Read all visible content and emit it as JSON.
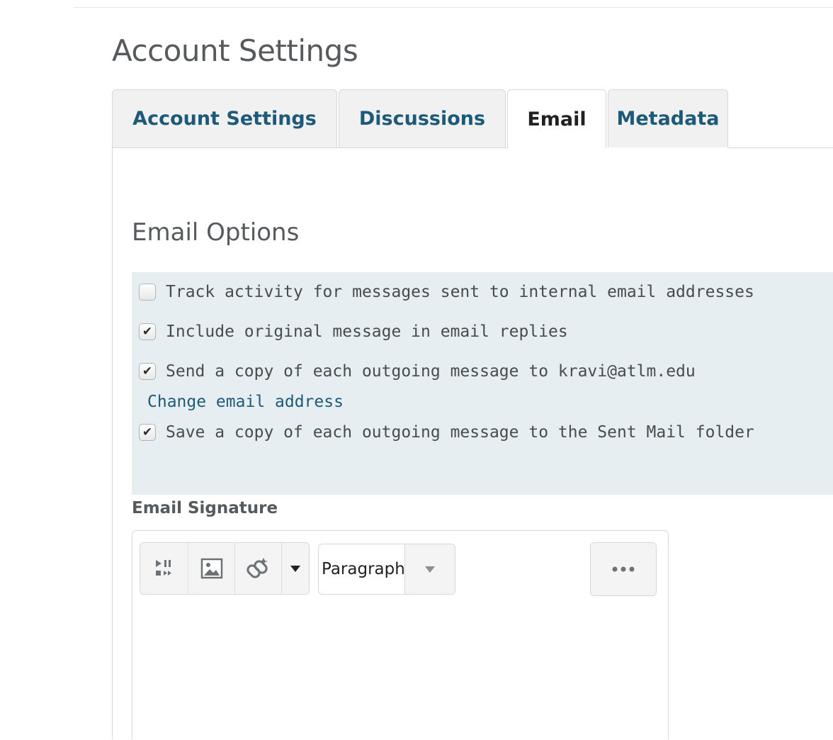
{
  "page": {
    "title": "Account Settings"
  },
  "tabs": [
    {
      "label": "Account Settings",
      "active": false
    },
    {
      "label": "Discussions",
      "active": false
    },
    {
      "label": "Email",
      "active": true
    },
    {
      "label": "Metadata",
      "active": false
    }
  ],
  "email_options": {
    "title": "Email Options",
    "options": [
      {
        "label": "Track activity for messages sent to internal email addresses",
        "checked": false
      },
      {
        "label": "Include original message in email replies",
        "checked": true
      },
      {
        "label": "Send a copy of each outgoing message to kravi@atlm.edu",
        "checked": true
      },
      {
        "label": "Save a copy of each outgoing message to the Sent Mail folder",
        "checked": true
      }
    ],
    "change_email_link": "Change email address"
  },
  "signature": {
    "label": "Email Signature",
    "toolbar": {
      "icons": [
        "media-player-icon",
        "insert-image-icon",
        "insert-link-icon",
        "chevron-down-icon"
      ],
      "format_value": "Paragraph",
      "more_icon": "more-options-icon"
    },
    "content": ""
  },
  "colors": {
    "tab_link": "#1d5a7a",
    "options_background": "#e6eef1",
    "heading": "#565a5c"
  }
}
